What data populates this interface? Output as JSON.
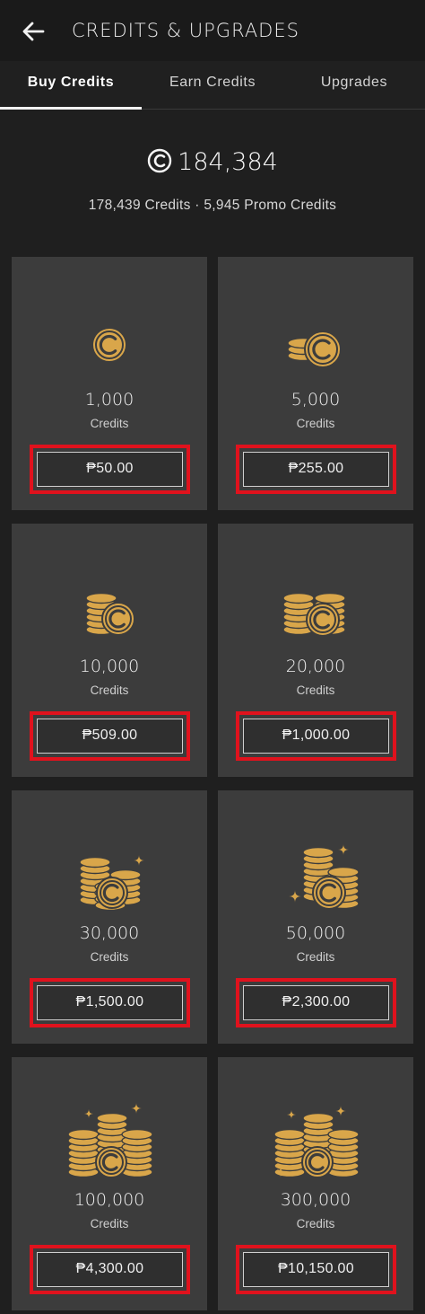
{
  "header": {
    "title": "CREDITS & UPGRADES",
    "back_icon": "arrow-left-icon"
  },
  "tabs": [
    {
      "label": "Buy Credits",
      "active": true
    },
    {
      "label": "Earn Credits",
      "active": false
    },
    {
      "label": "Upgrades",
      "active": false
    }
  ],
  "balance": {
    "total": "184,384",
    "breakdown": "178,439 Credits · 5,945 Promo Credits",
    "icon": "credit-c-icon"
  },
  "colors": {
    "gold": "#d9a64a",
    "highlight": "#e0121d",
    "card": "#3c3c3c"
  },
  "packages": [
    {
      "amount": "1,000",
      "unit": "Credits",
      "price": "₱50.00"
    },
    {
      "amount": "5,000",
      "unit": "Credits",
      "price": "₱255.00"
    },
    {
      "amount": "10,000",
      "unit": "Credits",
      "price": "₱509.00"
    },
    {
      "amount": "20,000",
      "unit": "Credits",
      "price": "₱1,000.00"
    },
    {
      "amount": "30,000",
      "unit": "Credits",
      "price": "₱1,500.00"
    },
    {
      "amount": "50,000",
      "unit": "Credits",
      "price": "₱2,300.00"
    },
    {
      "amount": "100,000",
      "unit": "Credits",
      "price": "₱4,300.00"
    },
    {
      "amount": "300,000",
      "unit": "Credits",
      "price": "₱10,150.00"
    }
  ]
}
